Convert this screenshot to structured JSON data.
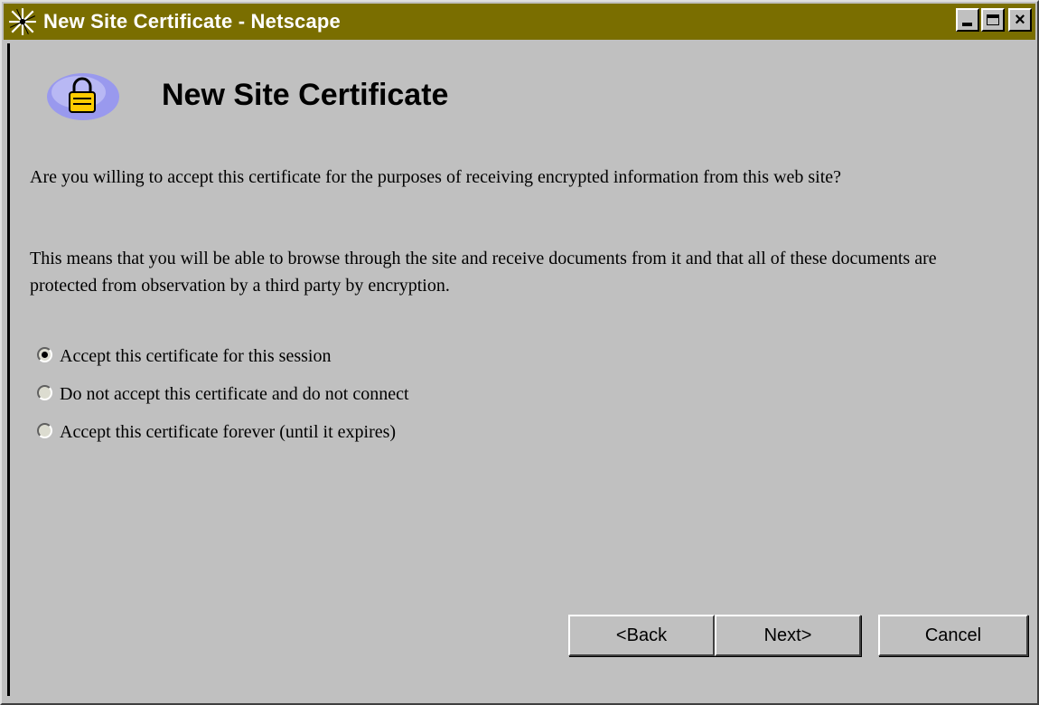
{
  "window": {
    "title": "New Site Certificate - Netscape",
    "app_icon": "netscape-icon",
    "controls": {
      "minimize": "minimize-icon",
      "maximize": "maximize-icon",
      "close": "close-icon"
    }
  },
  "header": {
    "icon": "lock-icon",
    "title": "New Site Certificate"
  },
  "body": {
    "question": "Are you willing to accept this certificate for the purposes of receiving encrypted information from this web site?",
    "explanation": "This means that you will be able to browse through the site and receive documents from it and that all of these documents are protected from observation by a third party by encryption."
  },
  "options": [
    {
      "label": "Accept this certificate for this session",
      "selected": true
    },
    {
      "label": "Do not accept this certificate and do not connect",
      "selected": false
    },
    {
      "label": "Accept this certificate forever (until it expires)",
      "selected": false
    }
  ],
  "buttons": {
    "back": "<Back",
    "next": "Next>",
    "cancel": "Cancel"
  },
  "colors": {
    "titlebar": "#7a6e00",
    "face": "#c0c0c0",
    "lock_badge": "#9999ee",
    "lock_body": "#ffcc00"
  }
}
